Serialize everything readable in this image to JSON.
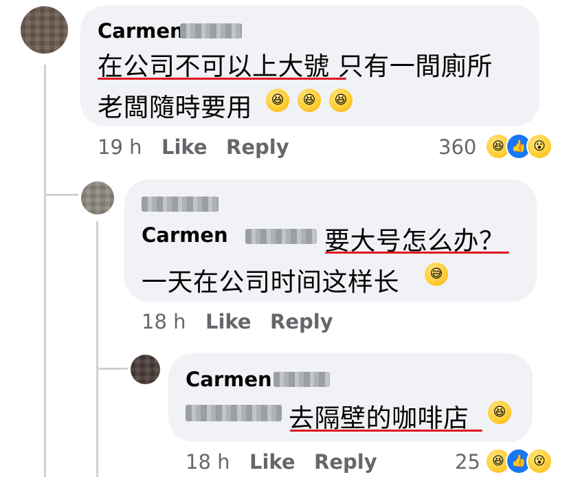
{
  "colors": {
    "bubble_bg": "#f0f2f5",
    "meta_text": "#65676b",
    "underline": "#e0141d",
    "like_blue": "#1877f2",
    "thread_line": "#ced0d4"
  },
  "comments": [
    {
      "author": "Carmen",
      "lines": [
        "在公司不可以上大號 只有一間廁所",
        "老闆隨時要用"
      ],
      "underlined_text": "在公司不可以上大號",
      "emoji": [
        "rolling-on-floor-laughing",
        "rolling-on-floor-laughing",
        "rolling-on-floor-laughing"
      ],
      "time": "19 h",
      "like_label": "Like",
      "reply_label": "Reply",
      "reaction_count": "360",
      "reactions": [
        "haha",
        "like",
        "wow"
      ]
    },
    {
      "author_mention": "Carmen",
      "line1": "要大号怎么办？",
      "line2": "一天在公司时间这样长",
      "underlined_text": "要大号怎么办？",
      "emoji": [
        "grinning-face-with-sweat"
      ],
      "time": "18 h",
      "like_label": "Like",
      "reply_label": "Reply"
    },
    {
      "author": "Carmen",
      "text": "去隔壁的咖啡店",
      "underlined_text": "去隔壁的咖啡店",
      "emoji": [
        "rolling-on-floor-laughing"
      ],
      "time": "18 h",
      "like_label": "Like",
      "reply_label": "Reply",
      "reaction_count": "25",
      "reactions": [
        "haha",
        "like",
        "wow"
      ]
    }
  ]
}
